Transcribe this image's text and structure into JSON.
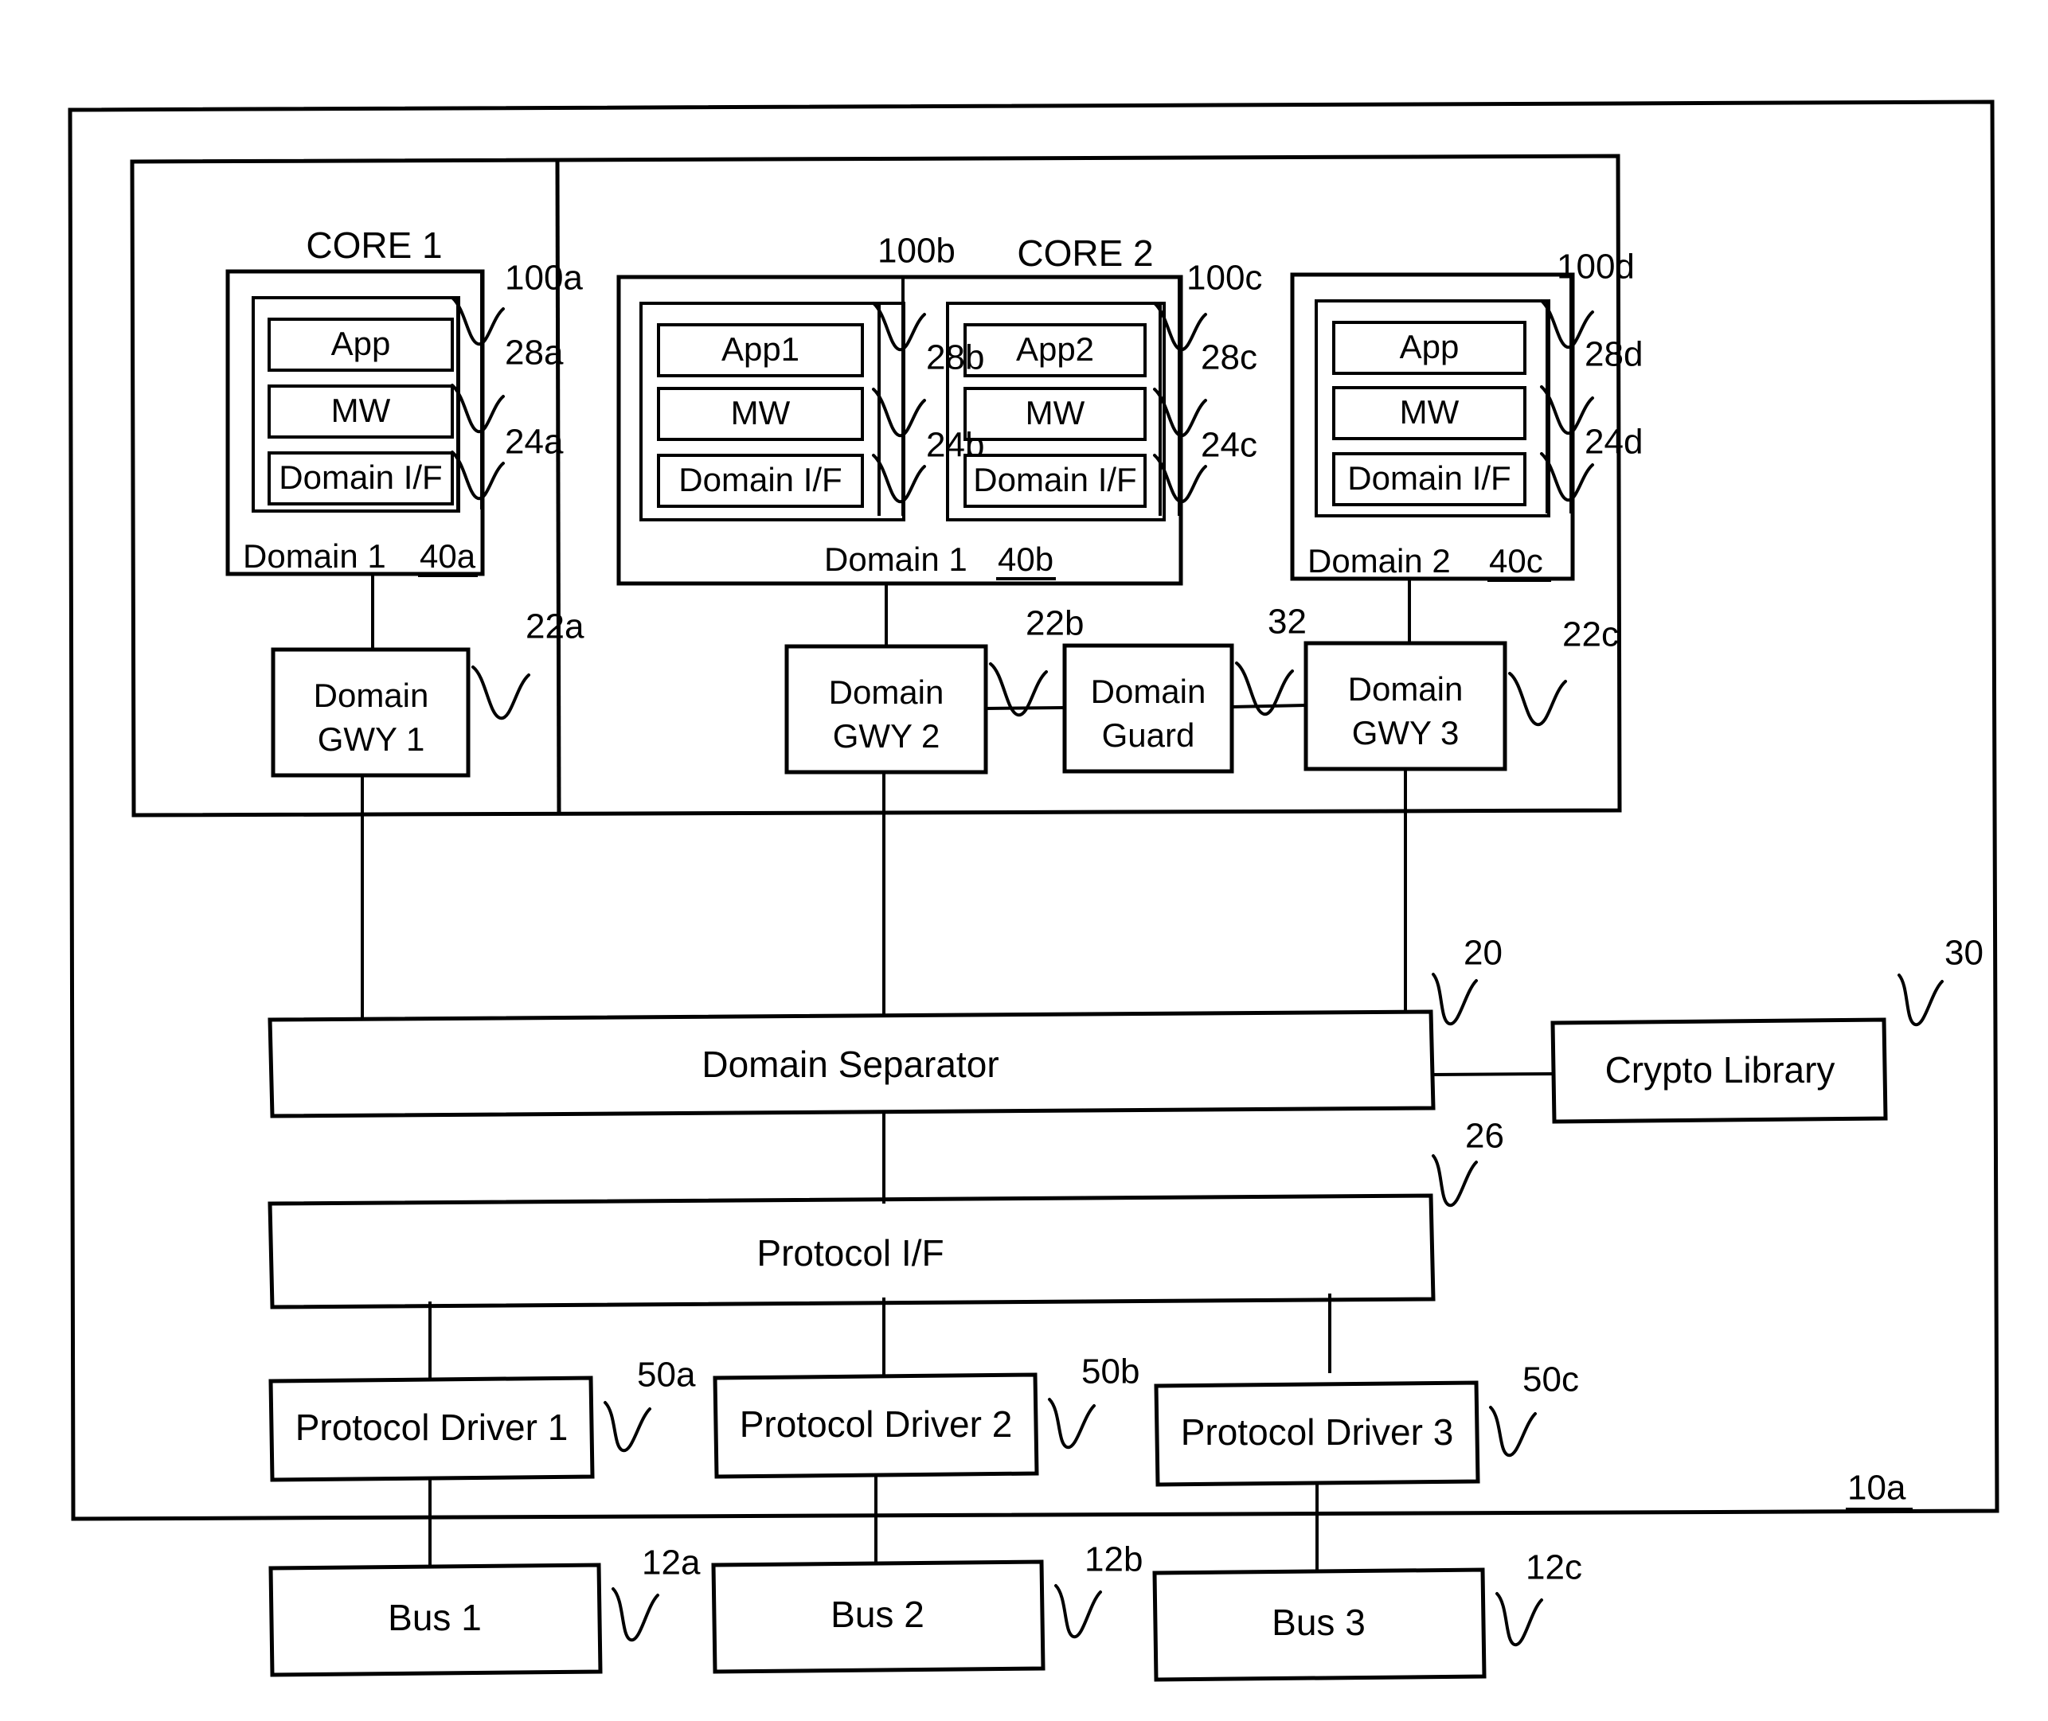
{
  "figure": {
    "outer_ref": "10a",
    "outer_right_ref": "30"
  },
  "cores": [
    {
      "label": "CORE 1"
    },
    {
      "label": "CORE 2"
    }
  ],
  "domains": [
    {
      "domain_label": "Domain 1",
      "domain_ref": "40a",
      "stack": [
        "App",
        "MW",
        "Domain I/F"
      ],
      "refs": {
        "outer": "100a",
        "mid": "28a",
        "inner": "24a"
      }
    },
    {
      "domain_label": "Domain 1",
      "domain_ref": "40b",
      "stack": [
        "App1",
        "MW",
        "Domain I/F"
      ],
      "refs": {
        "outer": "100b",
        "mid": "28b",
        "inner": "24b"
      }
    },
    {
      "domain_label": "",
      "domain_ref": "",
      "stack": [
        "App2",
        "MW",
        "Domain I/F"
      ],
      "refs": {
        "outer": "100c",
        "mid": "28c",
        "inner": "24c"
      }
    },
    {
      "domain_label": "Domain 2",
      "domain_ref": "40c",
      "stack": [
        "App",
        "MW",
        "Domain I/F"
      ],
      "refs": {
        "outer": "100d",
        "mid": "28d",
        "inner": "24d"
      }
    }
  ],
  "gateways": [
    {
      "line1": "Domain",
      "line2": "GWY 1",
      "ref": "22a"
    },
    {
      "line1": "Domain",
      "line2": "GWY 2",
      "ref": "22b"
    },
    {
      "line1": "Domain",
      "line2": "Guard",
      "ref": "32"
    },
    {
      "line1": "Domain",
      "line2": "GWY 3",
      "ref": "22c"
    }
  ],
  "separator": {
    "label": "Domain Separator",
    "ref": "20"
  },
  "crypto": {
    "label": "Crypto Library"
  },
  "protocol": {
    "label": "Protocol I/F",
    "ref": "26"
  },
  "drivers": [
    {
      "label": "Protocol Driver 1",
      "ref": "50a"
    },
    {
      "label": "Protocol Driver 2",
      "ref": "50b"
    },
    {
      "label": "Protocol Driver 3",
      "ref": "50c"
    }
  ],
  "buses": [
    {
      "label": "Bus 1",
      "ref": "12a"
    },
    {
      "label": "Bus 2",
      "ref": "12b"
    },
    {
      "label": "Bus 3",
      "ref": "12c"
    }
  ]
}
